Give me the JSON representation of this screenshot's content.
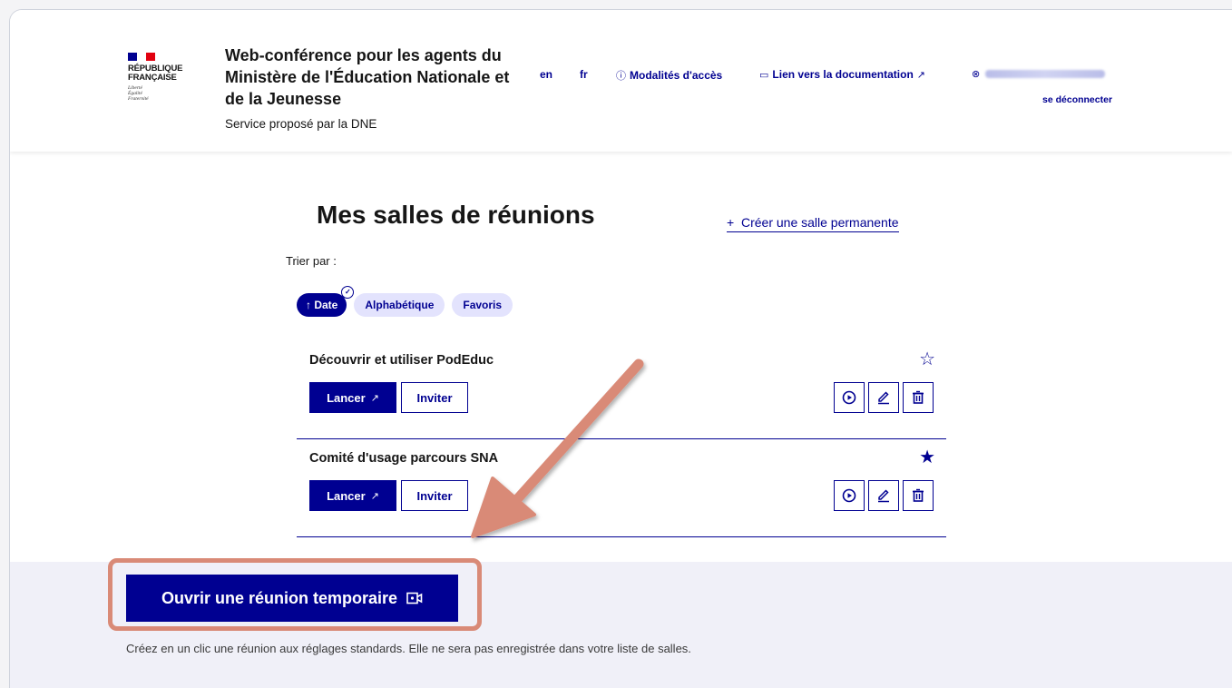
{
  "header": {
    "republic": [
      "RÉPUBLIQUE",
      "FRANÇAISE"
    ],
    "motto": [
      "Liberté",
      "Égalité",
      "Fraternité"
    ],
    "site_title": "Web-conférence pour les agents du Ministère de l'Éducation Nationale et de la Jeunesse",
    "site_subtitle": "Service proposé par la DNE",
    "nav": {
      "lang_en": "en",
      "lang_fr": "fr",
      "access": "Modalités d'accès",
      "docs": "Lien vers la documentation"
    },
    "logout": "se déconnecter"
  },
  "main": {
    "title": "Mes salles de réunions",
    "create_link": "Créer une salle permanente",
    "sort_label": "Trier par :",
    "sort_tags": [
      "Date",
      "Alphabétique",
      "Favoris"
    ],
    "rooms": [
      {
        "name": "Découvrir et utiliser PodEduc",
        "favorite": false
      },
      {
        "name": "Comité d'usage parcours SNA",
        "favorite": true
      }
    ],
    "launch_label": "Lancer",
    "invite_label": "Inviter"
  },
  "temporary": {
    "button": "Ouvrir une réunion temporaire",
    "description": "Créez en un clic une réunion aux réglages standards. Elle ne sera pas enregistrée dans votre liste de salles."
  },
  "colors": {
    "primary": "#000091",
    "tag_bg": "#e3e3fd",
    "band_bg": "#f0f0f8",
    "annotation": "#d98a77",
    "flag_red": "#e1000f"
  }
}
